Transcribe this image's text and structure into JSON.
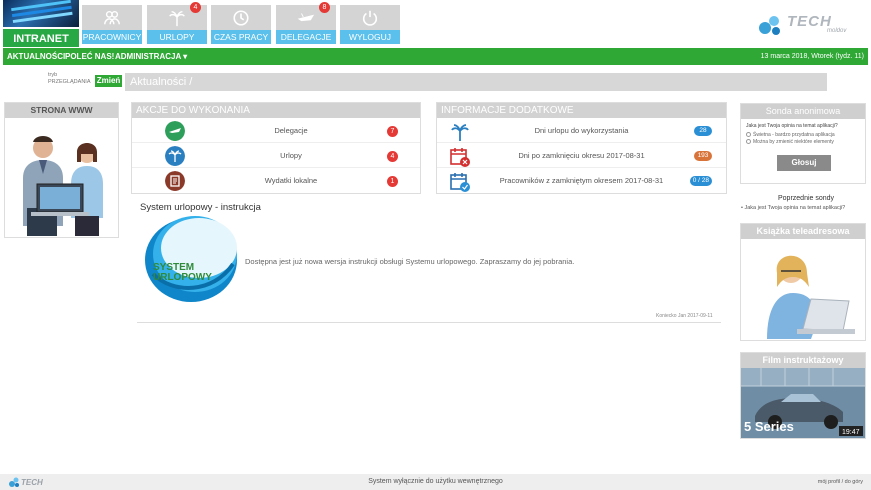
{
  "header": {
    "logo_label": "INTRANET",
    "brand_name": "TECH",
    "brand_sub": "moldov",
    "tiles": [
      {
        "label": "PRACOWNICY",
        "icon": "people-icon",
        "badge": ""
      },
      {
        "label": "URLOPY",
        "icon": "palm-tree-icon",
        "badge": "4"
      },
      {
        "label": "CZAS PRACY",
        "icon": "clock-icon",
        "badge": ""
      },
      {
        "label": "DELEGACJE",
        "icon": "plane-icon",
        "badge": "8"
      },
      {
        "label": "WYLOGUJ",
        "icon": "power-icon",
        "badge": ""
      }
    ]
  },
  "menu": {
    "items": [
      "AKTUALNOŚCI",
      "POLEĆ NAS!",
      "ADMINISTRACJA"
    ],
    "dropdown_arrow": "▾",
    "date": "13 marca 2018, Wtorek (tydz. 11)"
  },
  "breadcrumb": {
    "label_line1": "tryb",
    "label_line2": "PRZEGLĄDANIA",
    "change_button": "Zmień",
    "path": "Aktualności /"
  },
  "left_panel": {
    "title": "STRONA WWW"
  },
  "actions": {
    "title": "AKCJE DO WYKONANIA",
    "rows": [
      {
        "label": "Delegacje",
        "count": "7",
        "icon": "plane-icon",
        "color": "#2e9e5b"
      },
      {
        "label": "Urlopy",
        "count": "4",
        "icon": "palm-tree-icon",
        "color": "#2a7fc1"
      },
      {
        "label": "Wydatki lokalne",
        "count": "1",
        "icon": "document-icon",
        "color": "#8b3a2a"
      }
    ]
  },
  "info": {
    "title": "INFORMACJE DODATKOWE",
    "rows": [
      {
        "label": "Dni urlopu do wykorzystania",
        "value": "28",
        "color": "#2a8fd4",
        "icon": "palm-tree-icon"
      },
      {
        "label": "Dni po zamknięciu okresu 2017-08-31",
        "value": "193",
        "color": "#d8743a",
        "icon": "calendar-alert-icon"
      },
      {
        "label": "Pracowników z zamkniętym okresem 2017-08-31",
        "value": "0 / 28",
        "color": "#2a8fd4",
        "icon": "calendar-check-icon"
      }
    ]
  },
  "article": {
    "title": "System urlopowy - instrukcja",
    "image_text_1": "SYSTEM",
    "image_text_2": "URLOPOWY",
    "body": "Dostępna jest już nowa wersja instrukcji obsługi Systemu urlopowego. Zapraszamy do jej  pobrania.",
    "author": "Koniecko Jan 2017-09-11"
  },
  "poll": {
    "title": "Sonda anonimowa",
    "question": "Jaka jest Twoja opinia na temat aplikacji?",
    "options": [
      "Świetna - bardzo przydatna aplikacja",
      "Można by zmienić niektóre elementy"
    ],
    "vote_button": "Głosuj",
    "prev_title": "Poprzednie sondy",
    "prev_item": "• Jaka jest Twoja opinia na temat aplikacji?"
  },
  "phonebook": {
    "title": "Książka teleadresowa"
  },
  "film": {
    "title": "Film instruktażowy",
    "caption": "5 Series",
    "duration": "19:47"
  },
  "footer": {
    "text": "System wyłącznie do użytku wewnętrznego",
    "links": "mój profil  /  do góry",
    "brand": "TECH"
  }
}
